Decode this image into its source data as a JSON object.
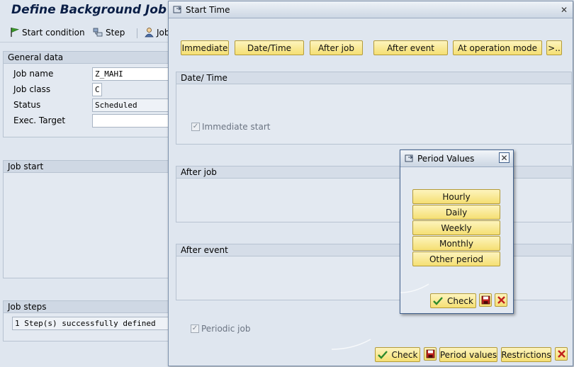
{
  "background": {
    "title": "Define Background Job",
    "toolbar": {
      "start_condition": "Start condition",
      "step": "Step",
      "job": "Job"
    },
    "general_data": {
      "header": "General data",
      "job_name_label": "Job name",
      "job_name_value": "Z_MAHI",
      "job_class_label": "Job class",
      "job_class_value": "C",
      "status_label": "Status",
      "status_value": "Scheduled",
      "exec_target_label": "Exec. Target",
      "exec_target_value": ""
    },
    "job_start": {
      "header": "Job start"
    },
    "job_steps": {
      "header": "Job steps",
      "message": "1 Step(s) successfully defined"
    }
  },
  "start_time_dialog": {
    "title": "Start Time",
    "buttons": {
      "immediate": "Immediate",
      "date_time": "Date/Time",
      "after_job": "After job",
      "after_event": "After event",
      "at_operation_mode": "At operation mode",
      "more": ">.."
    },
    "date_time_section": {
      "header": "Date/ Time",
      "immediate_start_label": "Immediate start",
      "immediate_start_checked": true
    },
    "after_job_section": {
      "header": "After job"
    },
    "after_event_section": {
      "header": "After event"
    },
    "periodic_job_label": "Periodic job",
    "periodic_job_checked": true,
    "footer": {
      "check": "Check",
      "period_values": "Period values",
      "restrictions": "Restrictions"
    }
  },
  "period_values_dialog": {
    "title": "Period Values",
    "options": [
      "Hourly",
      "Daily",
      "Weekly",
      "Monthly",
      "Other period"
    ],
    "check": "Check"
  },
  "colors": {
    "button_fill": "#f5df73",
    "title_blue": "#0a1e46",
    "cancel_red": "#c0201d",
    "check_green": "#2c8a2c"
  }
}
